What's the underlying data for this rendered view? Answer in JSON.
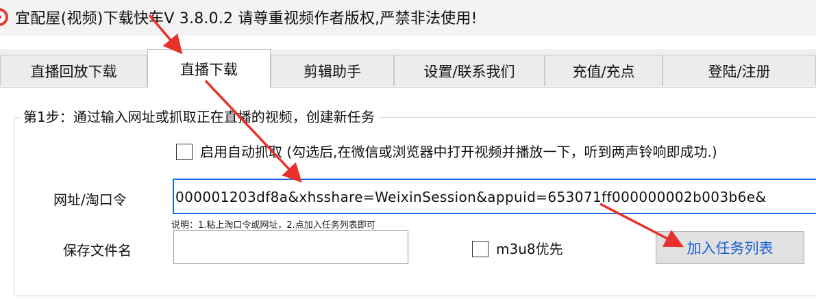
{
  "window": {
    "title": "宜配屋(视频)下载快车V 3.8.0.2 请尊重视频作者版权,严禁非法使用!"
  },
  "tabs": [
    {
      "label": "直播回放下载",
      "active": false
    },
    {
      "label": "直播下载",
      "active": true
    },
    {
      "label": "剪辑助手",
      "active": false
    },
    {
      "label": "设置/联系我们",
      "active": false
    },
    {
      "label": "充值/充点",
      "active": false
    },
    {
      "label": "登陆/注册",
      "active": false
    }
  ],
  "step": {
    "legend": "第1步：通过输入网址或抓取正在直播的视频，创建新任务",
    "auto_capture": {
      "checked": false,
      "label": "启用自动抓取 (勾选后,在微信或浏览器中打开视频并播放一下，听到两声铃响即成功.)"
    },
    "url": {
      "label": "网址/淘口令",
      "value": "000001203df8a&xhsshare=WeixinSession&appuid=653071ff000000002b003b6e&"
    },
    "hint": "说明：1.粘上淘口令或网址，2.点加入任务列表即可",
    "filename": {
      "label": "保存文件名",
      "value": ""
    },
    "m3u8": {
      "checked": false,
      "label": "m3u8优先"
    },
    "add_button": "加入任务列表"
  },
  "colors": {
    "accent_blue": "#1a6fe0",
    "button_text": "#1a5fd6",
    "arrow_red": "#e8312a",
    "icon_red": "#e43b2f"
  },
  "icons": {
    "app": "app-logo-icon",
    "arrow": "red-annotation-arrow"
  }
}
